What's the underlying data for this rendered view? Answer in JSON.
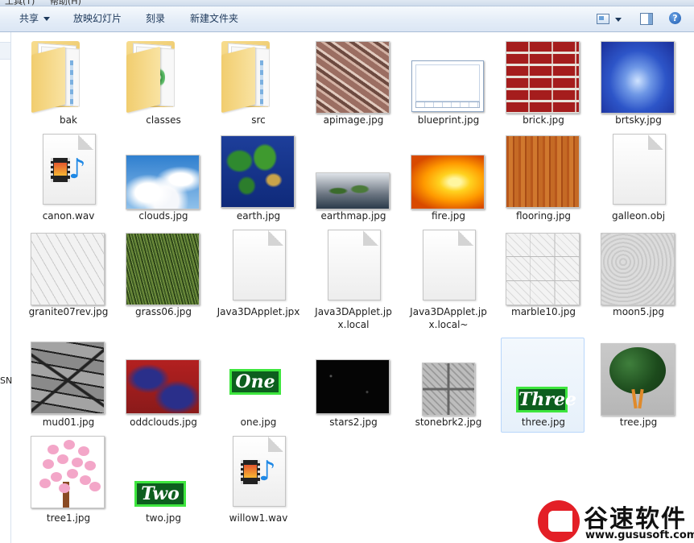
{
  "top_strip": {
    "left": "工具(T)",
    "right": "帮助(H)"
  },
  "toolbar": {
    "share": "共享",
    "slideshow": "放映幻灯片",
    "burn": "刻录",
    "new_folder": "新建文件夹"
  },
  "nav": {
    "fragment": "SN"
  },
  "items": [
    {
      "name": "bak",
      "kind": "folder"
    },
    {
      "name": "classes",
      "kind": "folder"
    },
    {
      "name": "src",
      "kind": "folder"
    },
    {
      "name": "apimage.jpg",
      "kind": "image"
    },
    {
      "name": "blueprint.jpg",
      "kind": "image"
    },
    {
      "name": "brick.jpg",
      "kind": "image"
    },
    {
      "name": "brtsky.jpg",
      "kind": "image"
    },
    {
      "name": "canon.wav",
      "kind": "audio"
    },
    {
      "name": "clouds.jpg",
      "kind": "image"
    },
    {
      "name": "earth.jpg",
      "kind": "image"
    },
    {
      "name": "earthmap.jpg",
      "kind": "image"
    },
    {
      "name": "fire.jpg",
      "kind": "image"
    },
    {
      "name": "flooring.jpg",
      "kind": "image"
    },
    {
      "name": "galleon.obj",
      "kind": "file"
    },
    {
      "name": "granite07rev.jpg",
      "kind": "image"
    },
    {
      "name": "grass06.jpg",
      "kind": "image"
    },
    {
      "name": "Java3DApplet.jpx",
      "kind": "file"
    },
    {
      "name": "Java3DApplet.jpx.local",
      "kind": "file"
    },
    {
      "name": "Java3DApplet.jpx.local~",
      "kind": "file"
    },
    {
      "name": "marble10.jpg",
      "kind": "image"
    },
    {
      "name": "moon5.jpg",
      "kind": "image"
    },
    {
      "name": "mud01.jpg",
      "kind": "image"
    },
    {
      "name": "oddclouds.jpg",
      "kind": "image"
    },
    {
      "name": "one.jpg",
      "kind": "image",
      "text": "One"
    },
    {
      "name": "stars2.jpg",
      "kind": "image"
    },
    {
      "name": "stonebrk2.jpg",
      "kind": "image"
    },
    {
      "name": "three.jpg",
      "kind": "image",
      "text": "Three",
      "selected": true
    },
    {
      "name": "tree.jpg",
      "kind": "image"
    },
    {
      "name": "tree1.jpg",
      "kind": "image"
    },
    {
      "name": "two.jpg",
      "kind": "image",
      "text": "Two"
    },
    {
      "name": "willow1.wav",
      "kind": "audio"
    }
  ],
  "watermark": {
    "brand": "谷速软件",
    "url": "www.gususoft.com"
  }
}
